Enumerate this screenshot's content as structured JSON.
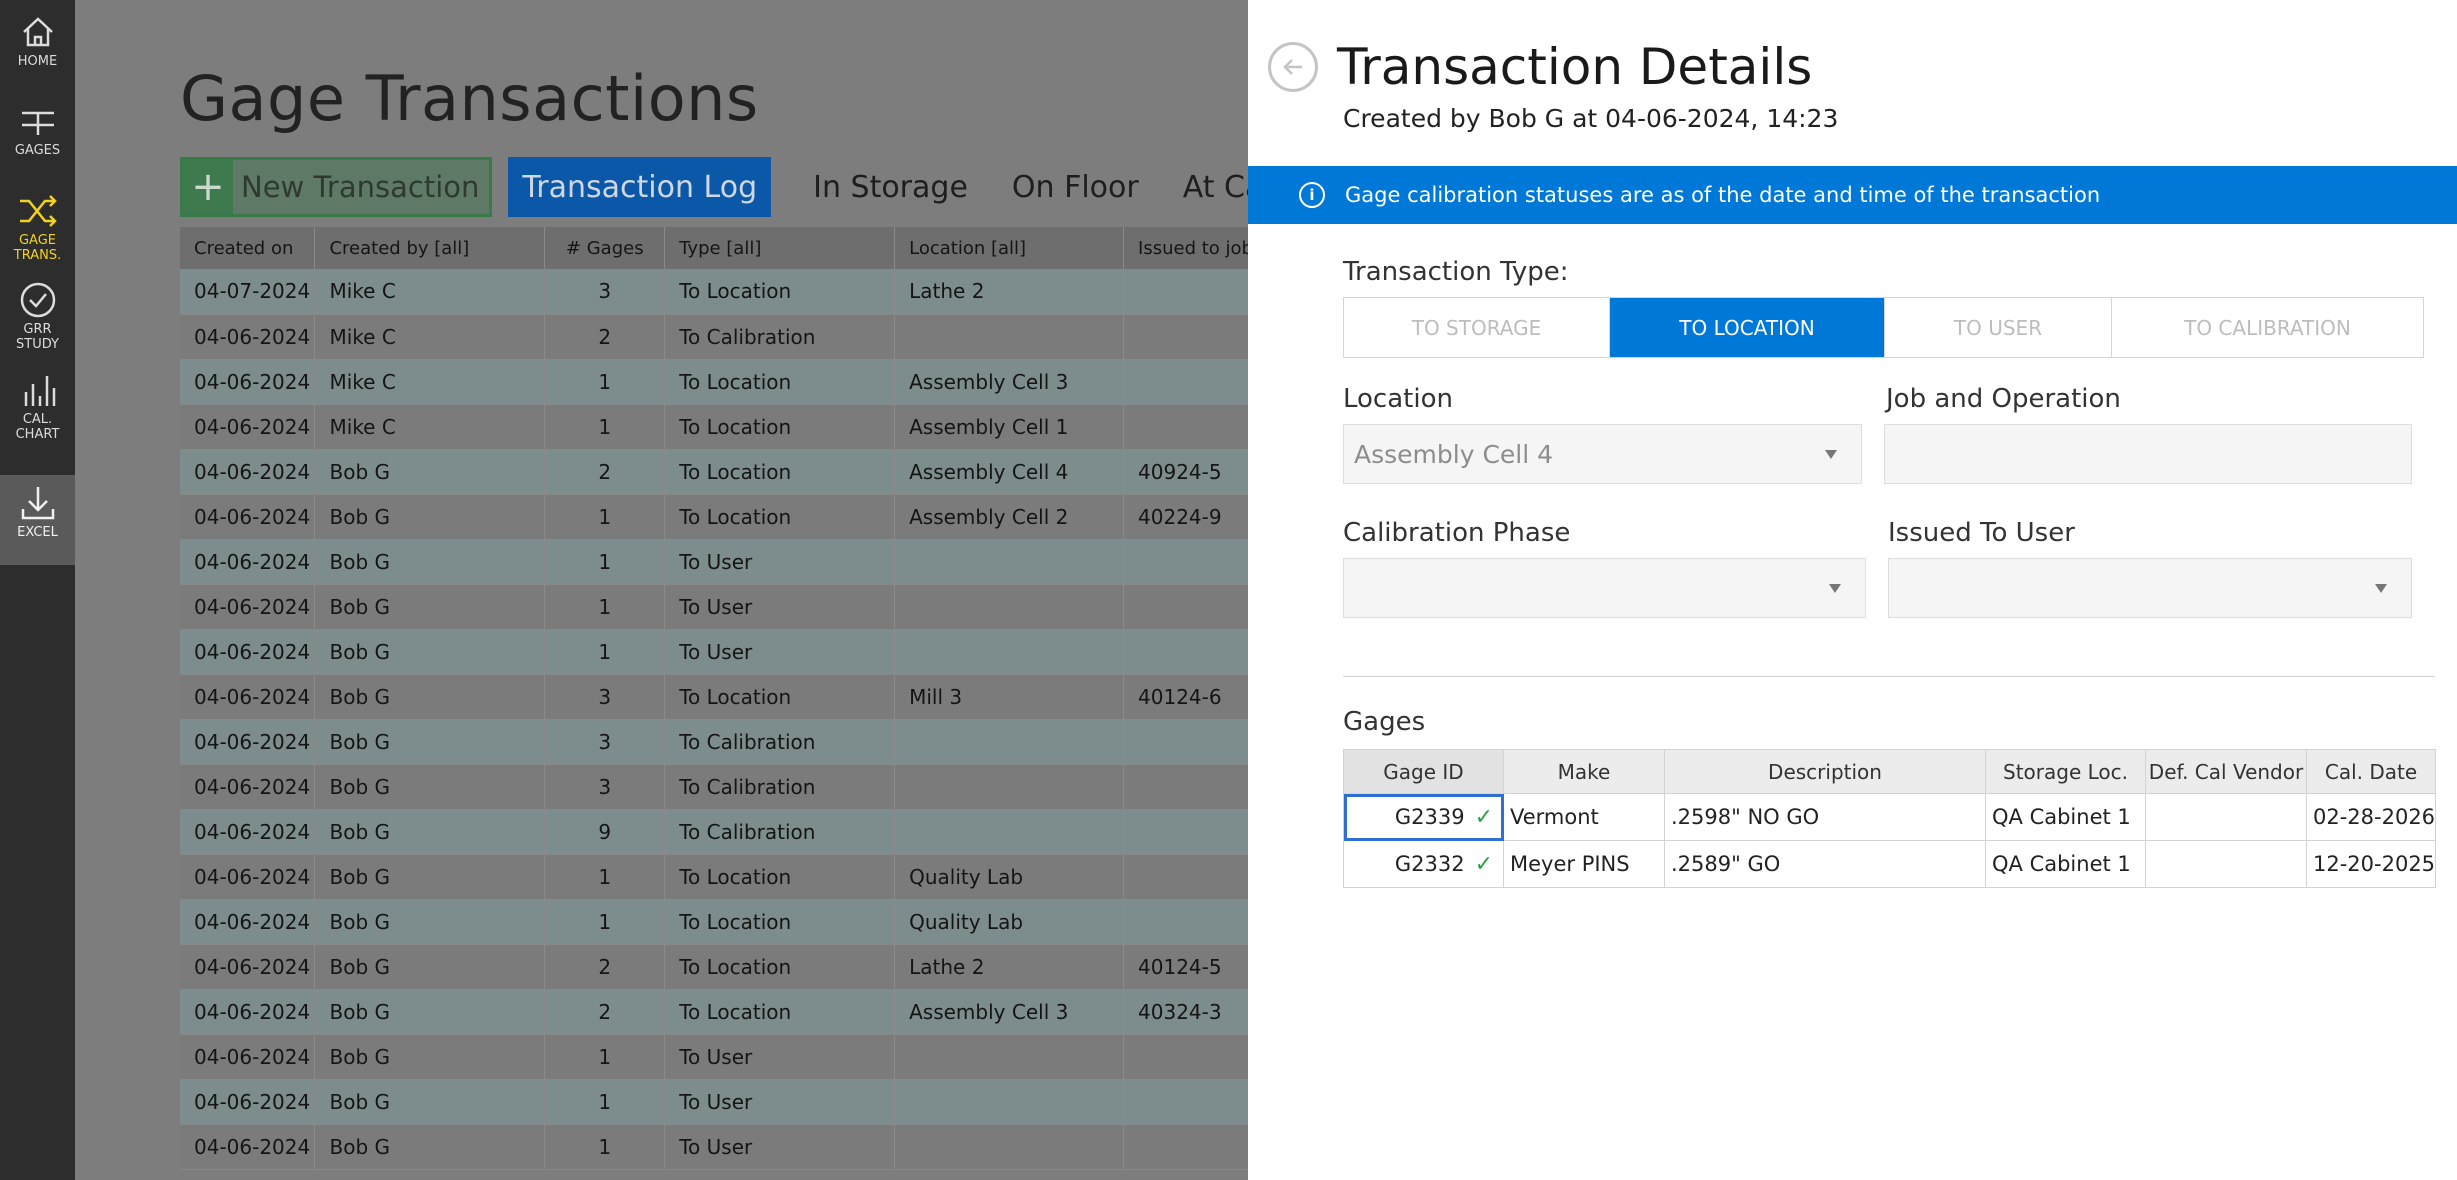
{
  "sidebar": {
    "items": [
      {
        "label": "HOME",
        "icon": "home-icon"
      },
      {
        "label": "GAGES",
        "icon": "gages-icon"
      },
      {
        "label": "GAGE TRANS.",
        "icon": "shuffle-icon"
      },
      {
        "label": "GRR STUDY",
        "icon": "check-circle-icon"
      },
      {
        "label": "CAL. CHART",
        "icon": "bar-chart-icon"
      },
      {
        "label": "EXCEL",
        "icon": "download-icon"
      }
    ],
    "active_color": "#f2d21c"
  },
  "main": {
    "title": "Gage Transactions",
    "new_button": "New Transaction",
    "tabs": [
      "Transaction Log",
      "In Storage",
      "On Floor",
      "At Calibrat"
    ],
    "columns": [
      "Created on",
      "Created by [all]",
      "# Gages",
      "Type [all]",
      "Location [all]",
      "Issued to job"
    ],
    "rows": [
      [
        "04-07-2024",
        "Mike C",
        "3",
        "To Location",
        "Lathe 2",
        ""
      ],
      [
        "04-06-2024",
        "Mike C",
        "2",
        "To Calibration",
        "",
        ""
      ],
      [
        "04-06-2024",
        "Mike C",
        "1",
        "To Location",
        "Assembly Cell 3",
        ""
      ],
      [
        "04-06-2024",
        "Mike C",
        "1",
        "To Location",
        "Assembly Cell 1",
        ""
      ],
      [
        "04-06-2024",
        "Bob G",
        "2",
        "To Location",
        "Assembly Cell 4",
        "40924-5"
      ],
      [
        "04-06-2024",
        "Bob G",
        "1",
        "To Location",
        "Assembly Cell 2",
        "40224-9"
      ],
      [
        "04-06-2024",
        "Bob G",
        "1",
        "To User",
        "",
        ""
      ],
      [
        "04-06-2024",
        "Bob G",
        "1",
        "To User",
        "",
        ""
      ],
      [
        "04-06-2024",
        "Bob G",
        "1",
        "To User",
        "",
        ""
      ],
      [
        "04-06-2024",
        "Bob G",
        "3",
        "To Location",
        "Mill 3",
        "40124-6"
      ],
      [
        "04-06-2024",
        "Bob G",
        "3",
        "To Calibration",
        "",
        ""
      ],
      [
        "04-06-2024",
        "Bob G",
        "3",
        "To Calibration",
        "",
        ""
      ],
      [
        "04-06-2024",
        "Bob G",
        "9",
        "To Calibration",
        "",
        ""
      ],
      [
        "04-06-2024",
        "Bob G",
        "1",
        "To Location",
        "Quality Lab",
        ""
      ],
      [
        "04-06-2024",
        "Bob G",
        "1",
        "To Location",
        "Quality Lab",
        ""
      ],
      [
        "04-06-2024",
        "Bob G",
        "2",
        "To Location",
        "Lathe 2",
        "40124-5"
      ],
      [
        "04-06-2024",
        "Bob G",
        "2",
        "To Location",
        "Assembly Cell 3",
        "40324-3"
      ],
      [
        "04-06-2024",
        "Bob G",
        "1",
        "To User",
        "",
        ""
      ],
      [
        "04-06-2024",
        "Bob G",
        "1",
        "To User",
        "",
        ""
      ],
      [
        "04-06-2024",
        "Bob G",
        "1",
        "To User",
        "",
        ""
      ]
    ]
  },
  "panel": {
    "title": "Transaction Details",
    "created_by": "Created by Bob G at 04-06-2024, 14:23",
    "info": "Gage calibration statuses are as of the date and time of the transaction",
    "type_label": "Transaction Type:",
    "type_options": [
      "TO STORAGE",
      "TO LOCATION",
      "TO USER",
      "TO CALIBRATION"
    ],
    "type_selected": "TO LOCATION",
    "location_label": "Location",
    "location_value": "Assembly Cell 4",
    "job_label": "Job and Operation",
    "job_value": "",
    "cal_phase_label": "Calibration Phase",
    "cal_phase_value": "",
    "issued_user_label": "Issued To User",
    "issued_user_value": "",
    "gages_title": "Gages",
    "gage_columns": [
      "Gage ID",
      "Make",
      "Description",
      "Storage Loc.",
      "Def. Cal Vendor",
      "Cal. Date"
    ],
    "gage_rows": [
      [
        "G2339",
        "Vermont",
        ".2598\" NO GO",
        "QA Cabinet 1",
        "",
        "02-28-2026"
      ],
      [
        "G2332",
        "Meyer PINS",
        ".2589\" GO",
        "QA Cabinet 1",
        "",
        "12-20-2025"
      ]
    ],
    "accent": "#0078d7"
  }
}
